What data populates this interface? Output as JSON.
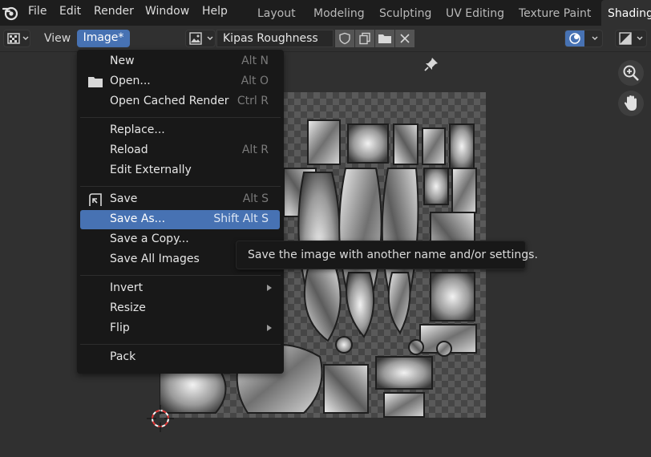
{
  "topbar": {
    "menus": [
      "File",
      "Edit",
      "Render",
      "Window",
      "Help"
    ],
    "workspace_tabs": [
      "Layout",
      "Modeling",
      "Sculpting",
      "UV Editing",
      "Texture Paint",
      "Shading"
    ],
    "active_tab": "Shading"
  },
  "header": {
    "view_label": "View",
    "image_label": "Image*",
    "image_name": "Kipas Roughness"
  },
  "dropdown": {
    "items": [
      {
        "label": "New",
        "shortcut": "Alt N"
      },
      {
        "label": "Open...",
        "shortcut": "Alt O",
        "icon": "folder-icon"
      },
      {
        "label": "Open Cached Render",
        "shortcut": "Ctrl R"
      },
      {
        "label": "Replace...",
        "shortcut": ""
      },
      {
        "label": "Reload",
        "shortcut": "Alt R"
      },
      {
        "label": "Edit Externally",
        "shortcut": ""
      },
      {
        "label": "Save",
        "shortcut": "Alt S",
        "icon": "save-icon"
      },
      {
        "label": "Save As...",
        "shortcut": "Shift Alt S",
        "highlighted": true
      },
      {
        "label": "Save a Copy...",
        "shortcut": ""
      },
      {
        "label": "Save All Images",
        "shortcut": ""
      },
      {
        "label": "Invert",
        "shortcut": "",
        "submenu": true
      },
      {
        "label": "Resize",
        "shortcut": ""
      },
      {
        "label": "Flip",
        "shortcut": "",
        "submenu": true
      },
      {
        "label": "Pack",
        "shortcut": ""
      }
    ]
  },
  "tooltip": {
    "text": "Save the image with another name and/or settings."
  },
  "colors": {
    "accent": "#4772b3",
    "menu_bg": "#181818",
    "topbar_bg": "#1d1d1d",
    "viewport_bg": "#303030"
  }
}
